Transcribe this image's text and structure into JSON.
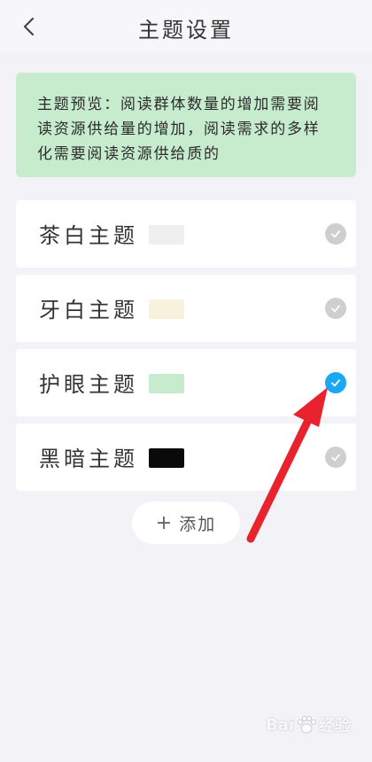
{
  "header": {
    "title": "主题设置",
    "back_icon": "chevron-left-icon"
  },
  "preview": {
    "text": "主题预览：阅读群体数量的增加需要阅读资源供给量的增加，阅读需求的多样化需要阅读资源供给质的",
    "background_color": "#c6ebcd"
  },
  "themes": [
    {
      "label": "茶白主题",
      "swatch_color": "#efefef",
      "selected": false
    },
    {
      "label": "牙白主题",
      "swatch_color": "#f8f1de",
      "selected": false
    },
    {
      "label": "护眼主题",
      "swatch_color": "#c6ebcd",
      "selected": true
    },
    {
      "label": "黑暗主题",
      "swatch_color": "#0a0a0a",
      "selected": false
    }
  ],
  "add_button": {
    "icon": "plus-icon",
    "label": "添加"
  },
  "annotation": {
    "arrow_color": "#e8232d"
  },
  "watermark": {
    "text_before": "Bai",
    "text_after": "经验"
  }
}
